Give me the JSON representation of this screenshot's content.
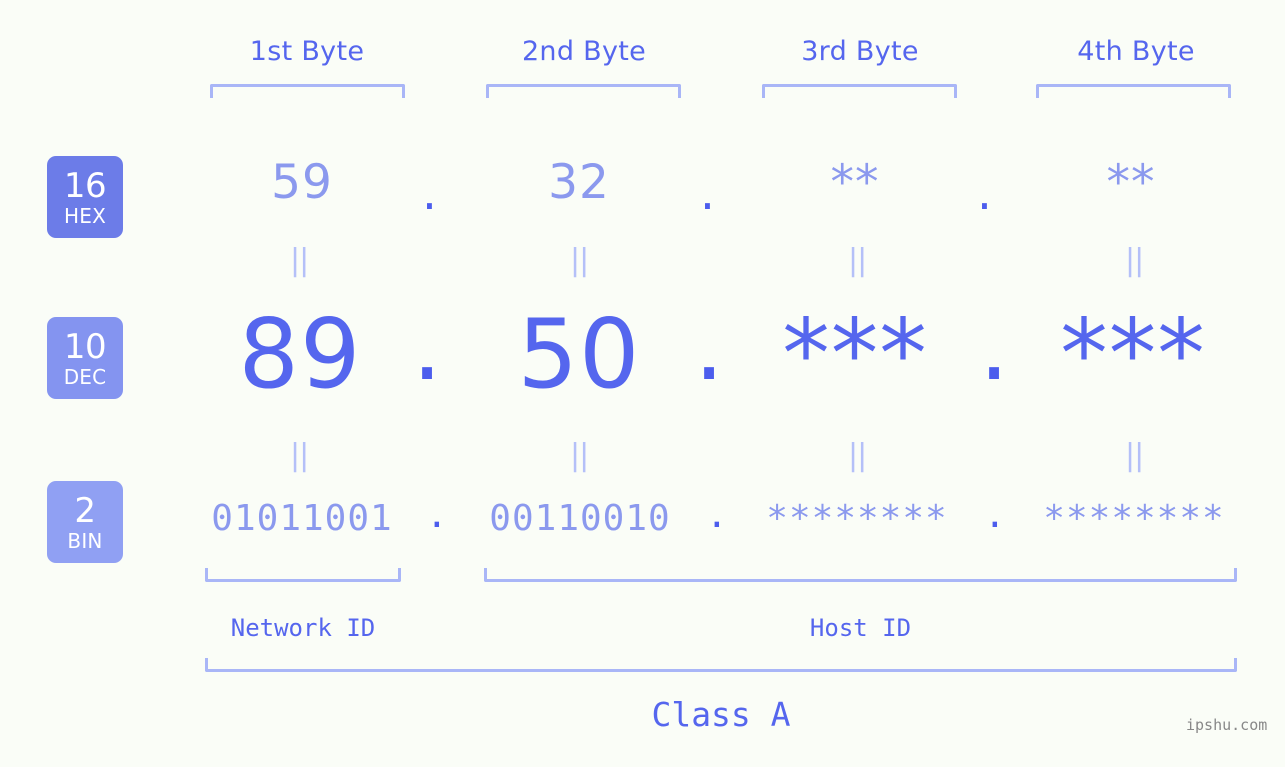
{
  "page": {
    "background_color": "#fafdf7",
    "accent_color": "#5566ee",
    "muted_accent_color": "#8b99ee",
    "bracket_color": "#a9b6f7",
    "watermark": "ipshu.com"
  },
  "byte_headers": [
    {
      "label": "1st Byte"
    },
    {
      "label": "2nd Byte"
    },
    {
      "label": "3rd Byte"
    },
    {
      "label": "4th Byte"
    }
  ],
  "bases": [
    {
      "number": "16",
      "name": "HEX",
      "color": "#6c7ce8"
    },
    {
      "number": "10",
      "name": "DEC",
      "color": "#8494f0"
    },
    {
      "number": "2",
      "name": "BIN",
      "color": "#90a0f3"
    }
  ],
  "rows": {
    "hex": {
      "values": [
        "59",
        "32",
        "**",
        "**"
      ],
      "separator": "."
    },
    "dec": {
      "values": [
        "89",
        "50",
        "***",
        "***"
      ],
      "separator": "."
    },
    "bin": {
      "values": [
        "01011001",
        "00110010",
        "********",
        "********"
      ],
      "separator": "."
    }
  },
  "equals_glyph": "||",
  "regions": [
    {
      "label": "Network ID"
    },
    {
      "label": "Host ID"
    }
  ],
  "class": {
    "label": "Class A"
  }
}
